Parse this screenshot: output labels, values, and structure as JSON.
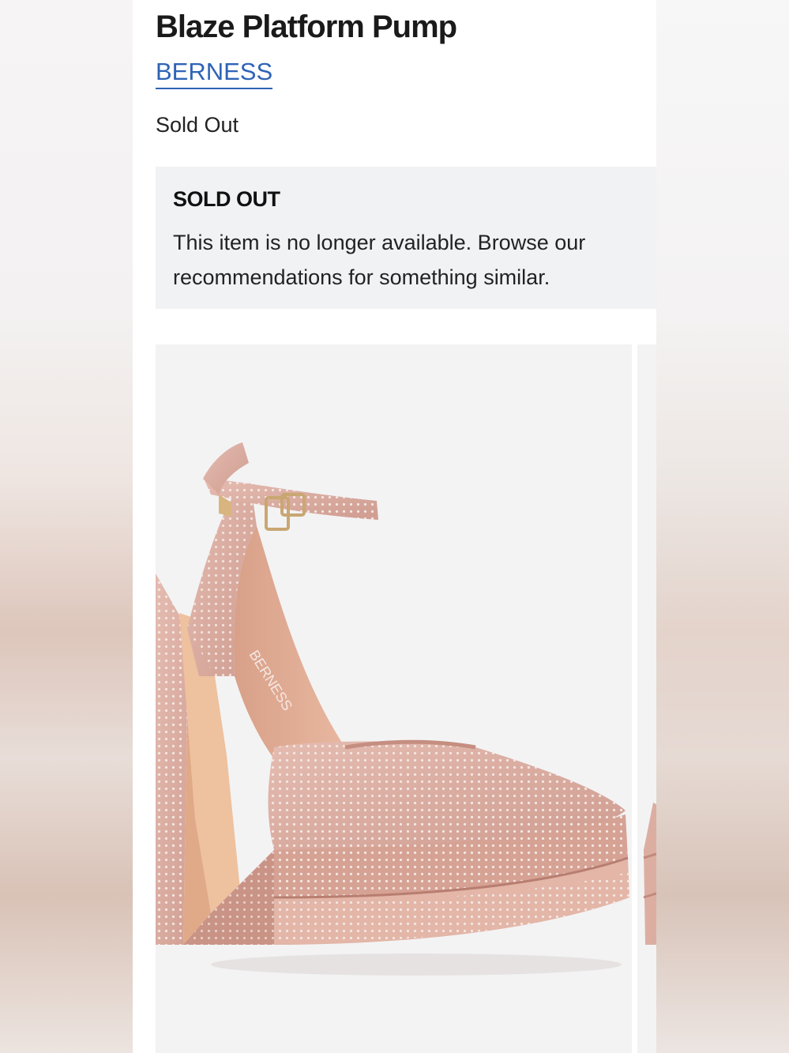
{
  "product": {
    "title": "Blaze Platform Pump",
    "brand": "BERNESS",
    "availability": "Sold Out"
  },
  "notice": {
    "heading": "SOLD OUT",
    "body": "This item is no longer available. Browse our recommendations for something similar."
  },
  "gallery": {
    "main_image_icon": "shoe-image",
    "insole_brand_text": "BERNESS"
  },
  "colors": {
    "brand_link": "#2f63b6",
    "notice_bg": "#f1f2f3",
    "shoe": "#d9a79d"
  }
}
